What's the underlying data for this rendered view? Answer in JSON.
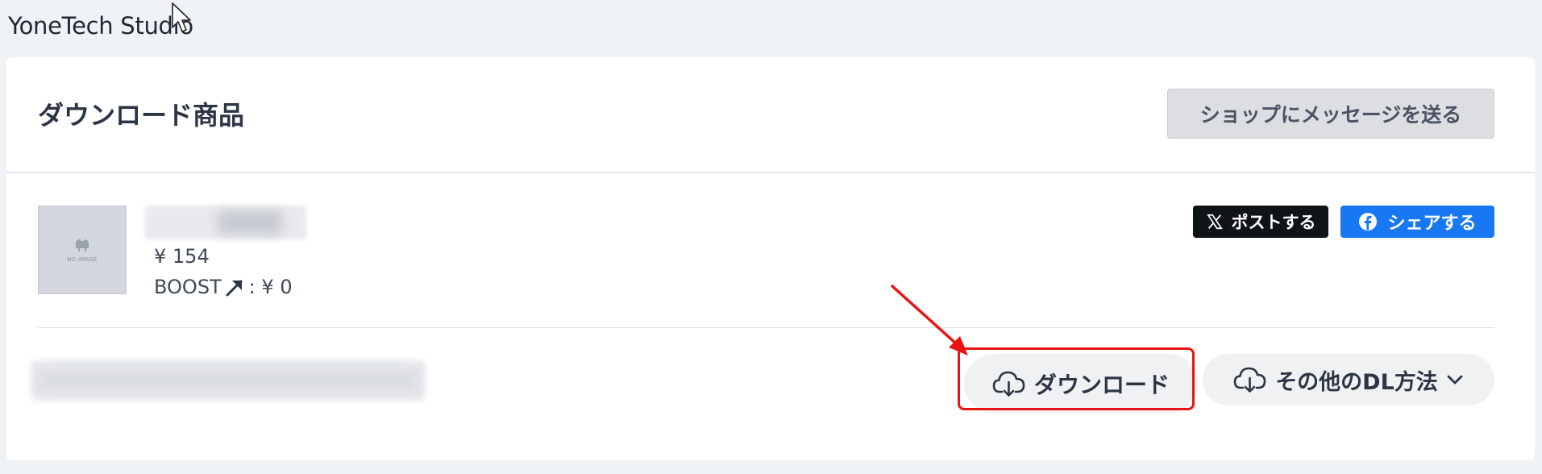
{
  "header": {
    "shop_name": "YoneTech Studio"
  },
  "card": {
    "title": "ダウンロード商品",
    "message_button_label": "ショップにメッセージを送る"
  },
  "product": {
    "thumbnail_text": "NO IMAGE",
    "price": "¥ 154",
    "boost_label": "BOOST",
    "boost_value": ": ¥ 0"
  },
  "share": {
    "x_label": "ポストする",
    "facebook_label": "シェアする"
  },
  "actions": {
    "download_label": "ダウンロード",
    "other_dl_label": "その他のDL方法"
  },
  "colors": {
    "facebook": "#1877f2",
    "x": "#0f1419",
    "highlight": "#e81414"
  }
}
